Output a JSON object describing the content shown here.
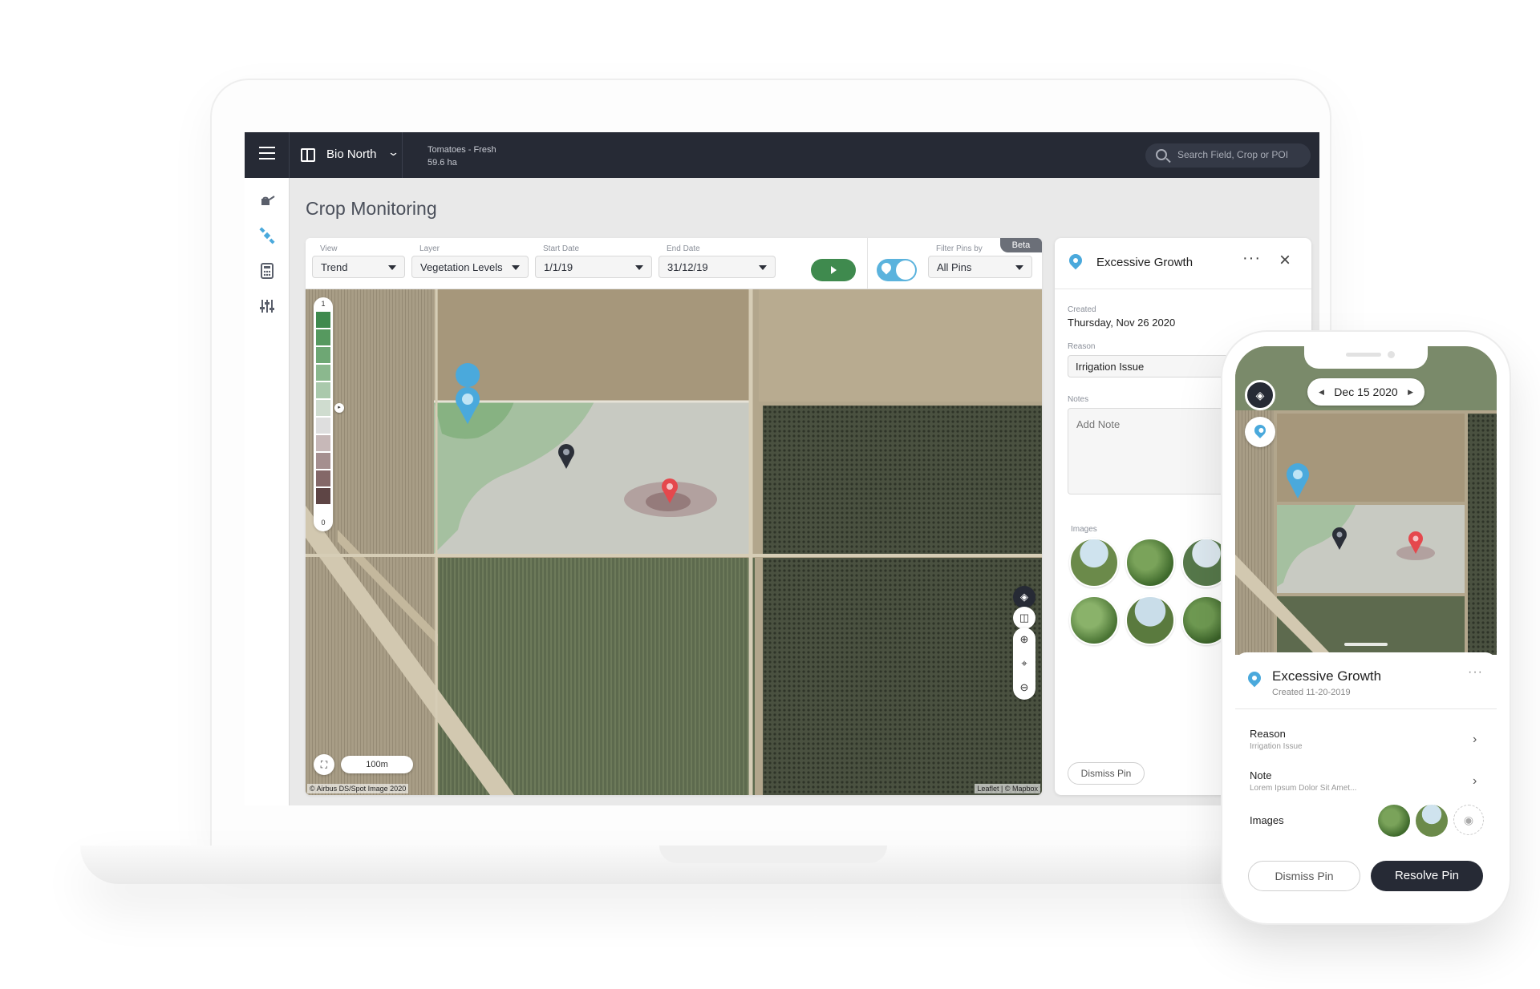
{
  "topbar": {
    "field_name": "Bio North",
    "crop_name": "Tomatoes - Fresh",
    "crop_area": "59.6 ha",
    "search_placeholder": "Search Field, Crop or POI"
  },
  "rail": {
    "items": [
      {
        "icon": "watering-can-icon"
      },
      {
        "icon": "satellite-icon"
      },
      {
        "icon": "calculator-icon"
      },
      {
        "icon": "sliders-icon"
      }
    ]
  },
  "page": {
    "title": "Crop Monitoring"
  },
  "toolbar": {
    "view_label": "View",
    "view_value": "Trend",
    "layer_label": "Layer",
    "layer_value": "Vegetation Levels",
    "start_label": "Start Date",
    "start_value": "1/1/19",
    "end_label": "End Date",
    "end_value": "31/12/19",
    "filter_label": "Filter Pins by",
    "filter_value": "All Pins",
    "beta": "Beta"
  },
  "map": {
    "legend_max": "1",
    "legend_min": "0",
    "legend_colors": [
      "#3f8a4e",
      "#56995f",
      "#6ea774",
      "#8bb88e",
      "#aac9ac",
      "#cfdccf",
      "#dedede",
      "#c7b8b8",
      "#a58f8f",
      "#846868",
      "#5e4545"
    ],
    "scale": "100m",
    "attribution_left": "© Airbus DS/Spot Image 2020",
    "attribution_right": "Leaflet | © Mapbox"
  },
  "panel": {
    "title": "Excessive Growth",
    "created_label": "Created",
    "created_value": "Thursday, Nov 26 2020",
    "reason_label": "Reason",
    "reason_value": "Irrigation Issue",
    "notes_label": "Notes",
    "notes_placeholder": "Add Note",
    "images_label": "Images",
    "dismiss_label": "Dismiss Pin"
  },
  "phone": {
    "date": "Dec 15 2020",
    "title": "Excessive Growth",
    "created": "Created 11-20-2019",
    "reason_label": "Reason",
    "reason_value": "Irrigation Issue",
    "note_label": "Note",
    "note_value": "Lorem Ipsum Dolor Sit Amet...",
    "images_label": "Images",
    "dismiss_label": "Dismiss Pin",
    "resolve_label": "Resolve Pin"
  },
  "colors": {
    "topbar": "#262a35",
    "accent_green": "#3f8a4e",
    "pin_blue": "#4aa9dc",
    "pin_red": "#e5484d",
    "pin_dark": "#2b2f38"
  }
}
